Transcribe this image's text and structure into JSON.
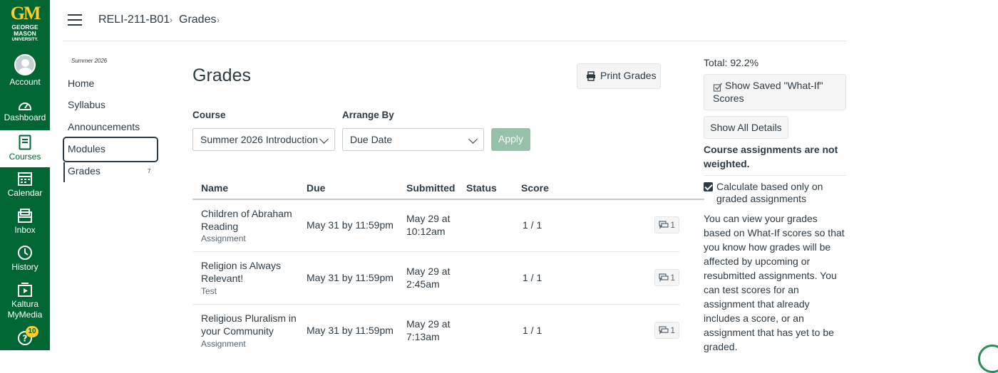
{
  "brand": {
    "logo_mark": "GM",
    "logo_line1": "GEORGE",
    "logo_line2": "MASON",
    "logo_line3": "UNIVERSITY."
  },
  "global_nav": {
    "account": "Account",
    "dashboard": "Dashboard",
    "courses": "Courses",
    "calendar": "Calendar",
    "inbox": "Inbox",
    "history": "History",
    "kaltura_line1": "Kaltura",
    "kaltura_line2": "MyMedia",
    "help_badge": "10"
  },
  "breadcrumb": {
    "course": "RELI-211-B01",
    "page": "Grades"
  },
  "course_nav": {
    "term": "Summer 2026",
    "items": [
      "Home",
      "Syllabus",
      "Announcements",
      "Modules",
      "Grades"
    ],
    "grades_count": "7"
  },
  "main": {
    "title": "Grades",
    "print_button": "Print Grades",
    "course_label": "Course",
    "course_value": "Summer 2026 Introduction",
    "arrange_label": "Arrange By",
    "arrange_value": "Due Date",
    "apply_button": "Apply"
  },
  "table": {
    "headers": [
      "Name",
      "Due",
      "Submitted",
      "Status",
      "Score"
    ],
    "rows": [
      {
        "name_line1": "Children of Abraham",
        "name_line2": "Reading",
        "type": "Assignment",
        "due": "May 31 by 11:59pm",
        "submitted_line1": "May 29 at",
        "submitted_line2": "10:12am",
        "status": "",
        "score": "1 / 1",
        "comments": "1"
      },
      {
        "name_line1": "Religion is Always",
        "name_line2": "Relevant!",
        "type": "Test",
        "due": "May 31 by 11:59pm",
        "submitted_line1": "May 29 at",
        "submitted_line2": "2:45am",
        "status": "",
        "score": "1 / 1",
        "comments": "1"
      },
      {
        "name_line1": "Religious Pluralism in",
        "name_line2": "your Community",
        "type": "Assignment",
        "due": "May 31 by 11:59pm",
        "submitted_line1": "May 29 at",
        "submitted_line2": "7:13am",
        "status": "",
        "score": "1 / 1",
        "comments": "1"
      }
    ]
  },
  "sidebar": {
    "total": "Total: 92.2%",
    "show_saved_line1": "Show Saved \"What-If\"",
    "show_saved_line2": "Scores",
    "show_all_details": "Show All Details",
    "weighted_note": "Course assignments are not weighted.",
    "calc_label": "Calculate based only on graded assignments",
    "calc_checked": true,
    "info_text": "You can view your grades based on What-If scores so that you know how grades will be affected by upcoming or resubmitted assignments. You can test scores for an assignment that already includes a score, or an assignment that has yet to be graded."
  },
  "colors": {
    "nav_green": "#006633",
    "gold": "#ffcc33",
    "apply_disabled": "#96c0a7",
    "text": "#2d3b45"
  }
}
